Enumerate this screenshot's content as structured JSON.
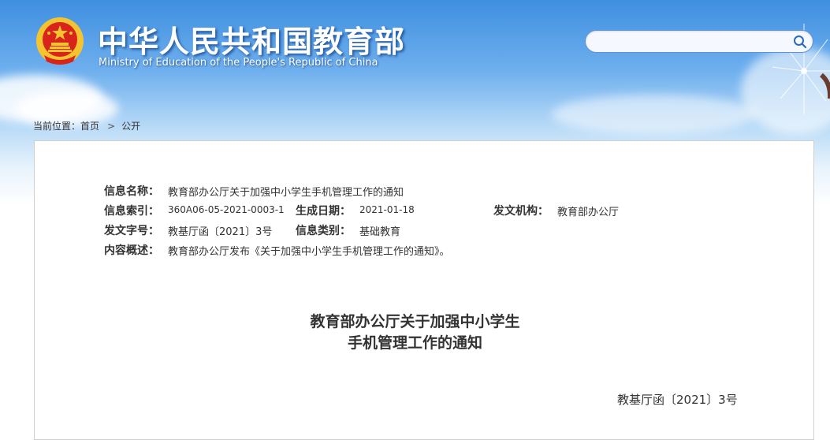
{
  "header": {
    "site_title": "中华人民共和国教育部",
    "site_subtitle": "Ministry of Education of the People's Republic of China",
    "search": {
      "placeholder": "",
      "icon": "search-icon"
    },
    "colors": {
      "sky_top": "#3f8fe0",
      "sky_bottom": "#e8f3fc",
      "emblem_red": "#d9241b",
      "emblem_gold": "#f4c430"
    }
  },
  "breadcrumb": {
    "prefix": "当前位置：",
    "items": [
      "首页",
      "公开"
    ],
    "separator": ">"
  },
  "info": {
    "name_label": "信息名称：",
    "name_value": "教育部办公厅关于加强中小学生手机管理工作的通知",
    "index_label": "信息索引：",
    "index_value": "360A06-05-2021-0003-1",
    "date_label": "生成日期：",
    "date_value": "2021-01-18",
    "issuer_label": "发文机构：",
    "issuer_value": "教育部办公厅",
    "doc_no_label": "发文字号：",
    "doc_no_value": "教基厅函〔2021〕3号",
    "category_label": "信息类别：",
    "category_value": "基础教育",
    "summary_label": "内容概述：",
    "summary_value": "教育部办公厅发布《关于加强中小学生手机管理工作的通知》。"
  },
  "document": {
    "title_line1": "教育部办公厅关于加强中小学生",
    "title_line2": "手机管理工作的通知",
    "number": "教基厅函〔2021〕3号"
  }
}
